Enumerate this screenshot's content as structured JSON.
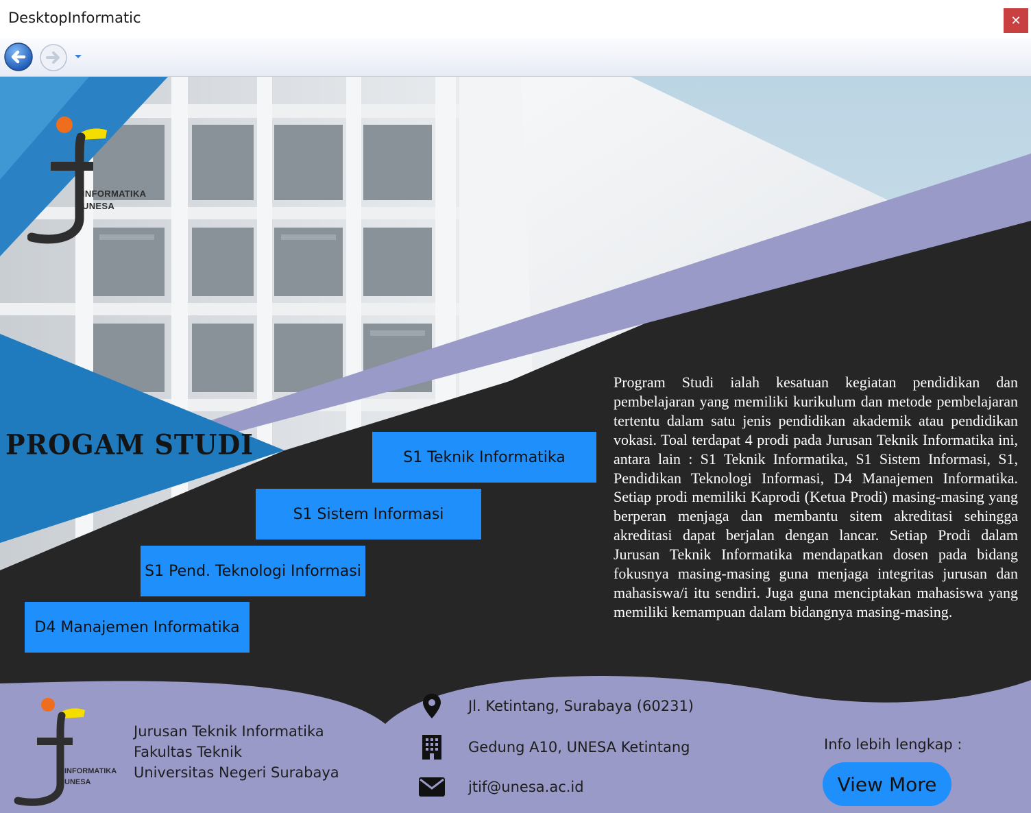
{
  "window": {
    "title": "DesktopInformatic",
    "close_symbol": "✕"
  },
  "navigation": {
    "back_icon": "back-arrow-icon",
    "forward_icon": "forward-arrow-icon",
    "history_icon": "chevron-down-icon"
  },
  "logo": {
    "line1": "INFORMATIKA",
    "line2": "UNESA"
  },
  "hero": {
    "heading": "PROGAM STUDI",
    "programs": [
      {
        "label": "S1 Teknik Informatika"
      },
      {
        "label": "S1 Sistem Informasi"
      },
      {
        "label": "S1 Pend. Teknologi Informasi"
      },
      {
        "label": "D4 Manajemen Informatika"
      }
    ],
    "description": "Program Studi ialah kesatuan kegiatan pendidikan dan pembelajaran yang memiliki kurikulum dan metode pembelajaran tertentu dalam satu jenis pendidikan akademik atau pendidikan vokasi. Toal terdapat 4 prodi pada Jurusan Teknik Informatika ini, antara lain : S1 Teknik Informatika, S1 Sistem Informasi, S1, Pendidikan Teknologi Informasi, D4 Manajemen Informatika. Setiap prodi memiliki Kaprodi (Ketua Prodi) masing-masing yang berperan menjaga dan membantu sitem akreditasi sehingga akreditasi dapat berjalan dengan lancar. Setiap Prodi dalam Jurusan Teknik Informatika mendapatkan dosen pada bidang fokusnya masing-masing guna menjaga integritas jurusan dan mahasiswa/i itu sendiri. Juga guna menciptakan mahasiswa yang memiliki kemampuan dalam bidangnya masing-masing."
  },
  "footer": {
    "department": "Jurusan Teknik Informatika",
    "faculty": "Fakultas Teknik",
    "university": "Universitas Negeri Surabaya",
    "address": "Jl. Ketintang, Surabaya (60231)",
    "building": "Gedung A10, UNESA Ketintang",
    "email": "jtif@unesa.ac.id",
    "info_label": "Info lebih lengkap :",
    "view_more": "View More"
  },
  "colors": {
    "accent": "#1e8ffb",
    "dark": "#262626",
    "lavender": "#9a9ac8",
    "blue": "#2a82c4",
    "orange": "#ee6e1e",
    "yellow": "#f5dd00"
  }
}
